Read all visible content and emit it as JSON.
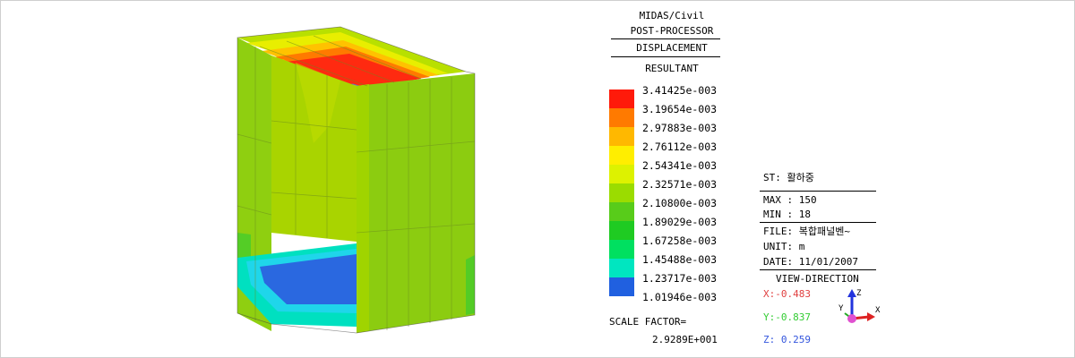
{
  "header": {
    "app": "MIDAS/Civil",
    "module": "POST-PROCESSOR",
    "result_type": "DISPLACEMENT",
    "component": "RESULTANT"
  },
  "legend": {
    "levels": [
      {
        "value": "3.41425e-003",
        "color": "#ff1a0a"
      },
      {
        "value": "3.19654e-003",
        "color": "#ff7a00"
      },
      {
        "value": "2.97883e-003",
        "color": "#ffb800"
      },
      {
        "value": "2.76112e-003",
        "color": "#ffee00"
      },
      {
        "value": "2.54341e-003",
        "color": "#ddf200"
      },
      {
        "value": "2.32571e-003",
        "color": "#9bdc00"
      },
      {
        "value": "2.10800e-003",
        "color": "#58cc1a"
      },
      {
        "value": "1.89029e-003",
        "color": "#1fcb22"
      },
      {
        "value": "1.67258e-003",
        "color": "#00e060"
      },
      {
        "value": "1.45488e-003",
        "color": "#00e6c0"
      },
      {
        "value": "1.23717e-003",
        "color": "#2ad8f2"
      },
      {
        "value": "1.01946e-003",
        "color": "#2060e0"
      }
    ]
  },
  "scale_factor": {
    "label": "SCALE FACTOR=",
    "value": "2.9289E+001"
  },
  "info": {
    "st": "ST: 활하중",
    "max": "MAX : 150",
    "min": "MIN : 18",
    "file": "FILE: 복합패널벤~",
    "unit": "UNIT: m",
    "date": "DATE: 11/01/2007"
  },
  "view_direction": {
    "title": "VIEW-DIRECTION",
    "x": "X:-0.483",
    "y": "Y:-0.837",
    "z": "Z: 0.259",
    "x_color": "#e04040",
    "y_color": "#33cc33",
    "z_color": "#3355dd",
    "axis_labels": {
      "x": "X",
      "y": "Y",
      "z": "Z"
    }
  }
}
